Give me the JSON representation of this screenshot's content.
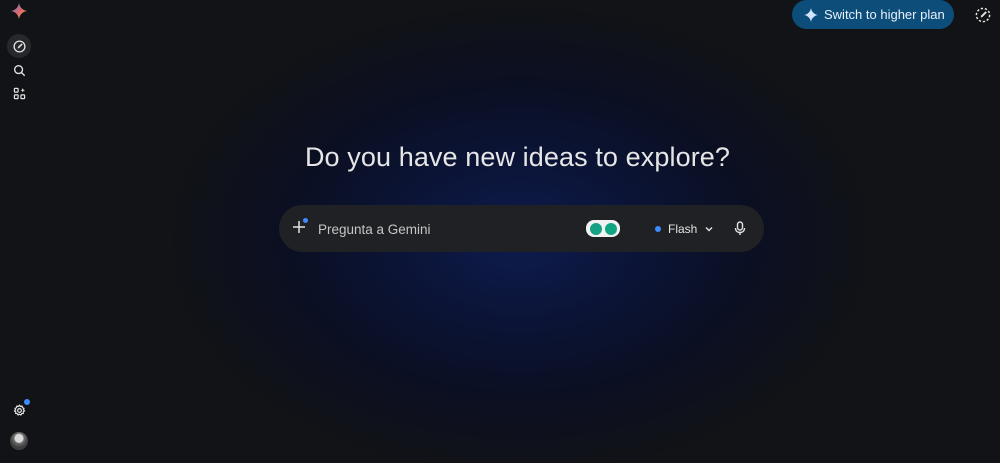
{
  "headline": "Do you have new ideas to explore?",
  "upgrade": {
    "label": "Switch to higher plan"
  },
  "prompt": {
    "placeholder": "Pregunta a Gemini"
  },
  "model": {
    "label": "Flash"
  },
  "colors": {
    "accent": "#3b8cff",
    "upgrade_bg": "#0d4d7a",
    "surface": "#202124"
  },
  "icons": [
    "gemini-logo",
    "new-chat-icon",
    "search-icon",
    "apps-icon",
    "settings-icon",
    "avatar",
    "sparkle-icon",
    "edit-icon",
    "plus-icon",
    "grammarly-icon",
    "chevron-down-icon",
    "mic-icon"
  ]
}
